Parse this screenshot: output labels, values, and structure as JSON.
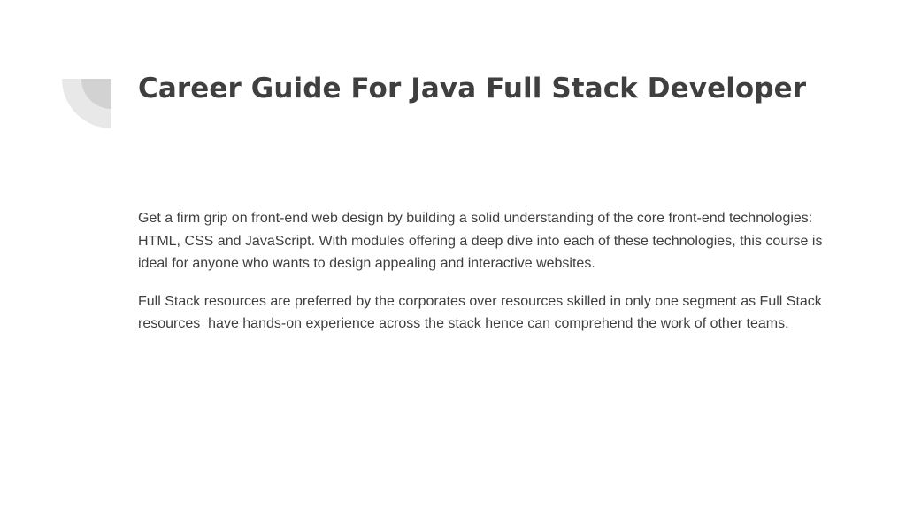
{
  "slide": {
    "title": "Career Guide For Java Full Stack Developer",
    "paragraphs": [
      "Get a firm grip on front-end web design by building a solid understanding of the core front-end technologies: HTML, CSS and JavaScript. With modules offering a deep dive into each of these technologies, this course is ideal for anyone who wants to design appealing and interactive websites.",
      "Full Stack resources are preferred by the corporates over resources skilled in only one segment as Full Stack resources  have hands-on experience across the stack hence can comprehend the work of other teams."
    ],
    "colors": {
      "text": "#3f3f3f",
      "decor_outer": "#e8e8e8",
      "decor_inner": "#d2d2d2",
      "background": "#ffffff"
    }
  }
}
